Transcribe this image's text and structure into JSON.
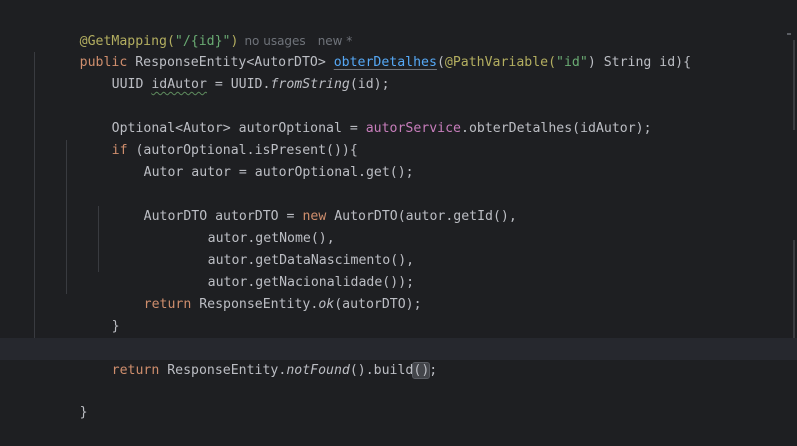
{
  "editor": {
    "lines": [
      {
        "annotation": "@GetMapping(",
        "string": "\"/{id}\"",
        "close": ")",
        "hint_usages": "no usages",
        "hint_new": "new *"
      },
      {
        "kw": "public ",
        "type": "ResponseEntity<AutorDTO> ",
        "method": "obterDetalhes",
        "open": "(",
        "param_ann": "@PathVariable(",
        "param_str": "\"id\"",
        "param_rest": ") String id){"
      },
      {
        "text_a": "UUID ",
        "var": "idAutor",
        "text_b": " = UUID.",
        "static_call": "fromString",
        "text_c": "(id);"
      },
      {},
      {
        "text_a": "Optional<Autor> autorOptional = ",
        "field": "autorService",
        "text_b": ".obterDetalhes(idAutor);"
      },
      {
        "kw": "if",
        "text_a": " (autorOptional.isPresent()){"
      },
      {
        "text_a": "Autor autor = autorOptional.get();"
      },
      {},
      {
        "text_a": "AutorDTO autorDTO = ",
        "kw": "new",
        "text_b": " AutorDTO(autor.getId(),"
      },
      {
        "text_a": "autor.getNome(),"
      },
      {
        "text_a": "autor.getDataNascimento(),"
      },
      {
        "text_a": "autor.getNacionalidade());"
      },
      {
        "kw": "return",
        "text_a": " ResponseEntity.",
        "static_call": "ok",
        "text_b": "(autorDTO);"
      },
      {
        "text_a": "}"
      },
      {},
      {
        "kw": "return",
        "text_a": " ResponseEntity.",
        "static_call": "notFound",
        "text_b": "().build",
        "brace": "()",
        "text_c": ";"
      },
      {},
      {
        "text_a": "}"
      }
    ]
  }
}
